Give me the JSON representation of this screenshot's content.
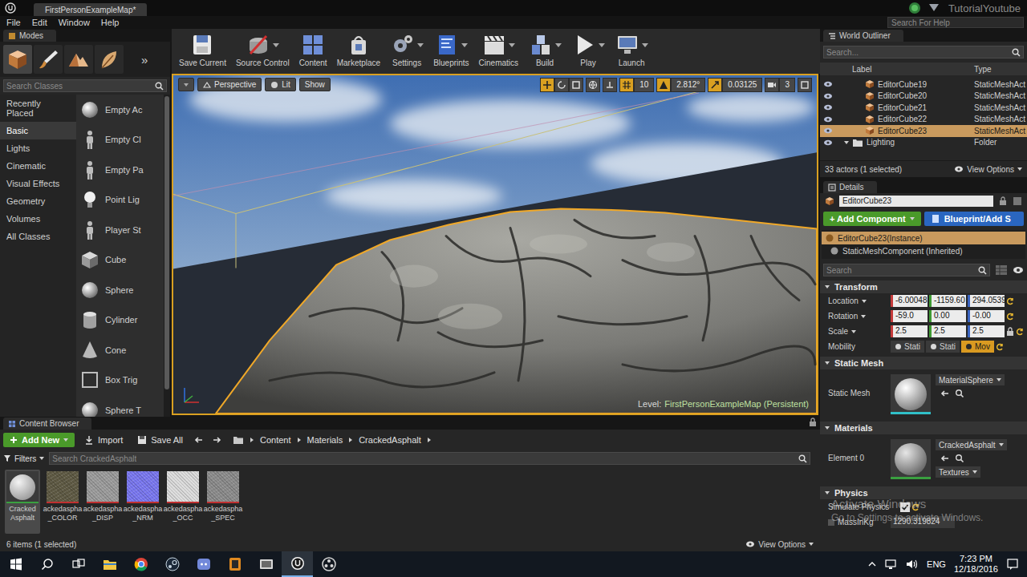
{
  "window": {
    "title": "FirstPersonExampleMap*",
    "account": "TutorialYoutube",
    "help_search": "Search For Help"
  },
  "menu": [
    "File",
    "Edit",
    "Window",
    "Help"
  ],
  "modes": {
    "tab": "Modes",
    "more": "»",
    "search": "Search Classes",
    "categories": [
      {
        "label": "Recently Placed",
        "selected": false
      },
      {
        "label": "Basic",
        "selected": true
      },
      {
        "label": "Lights",
        "selected": false
      },
      {
        "label": "Cinematic",
        "selected": false
      },
      {
        "label": "Visual Effects",
        "selected": false
      },
      {
        "label": "Geometry",
        "selected": false
      },
      {
        "label": "Volumes",
        "selected": false
      },
      {
        "label": "All Classes",
        "selected": false
      }
    ],
    "items": [
      "Empty Ac",
      "Empty Cl",
      "Empty Pa",
      "Point Lig",
      "Player St",
      "Cube",
      "Sphere",
      "Cylinder",
      "Cone",
      "Box Trig",
      "Sphere T"
    ]
  },
  "toolbar": [
    {
      "label": "Save Current",
      "dropdown": false
    },
    {
      "label": "Source Control",
      "dropdown": true
    },
    {
      "label": "Content",
      "dropdown": false
    },
    {
      "label": "Marketplace",
      "dropdown": false
    },
    {
      "label": "Settings",
      "dropdown": true
    },
    {
      "label": "Blueprints",
      "dropdown": true
    },
    {
      "label": "Cinematics",
      "dropdown": true
    },
    {
      "label": "Build",
      "dropdown": true
    },
    {
      "label": "Play",
      "dropdown": true
    },
    {
      "label": "Launch",
      "dropdown": true
    }
  ],
  "viewport": {
    "view": "Perspective",
    "lighting": "Lit",
    "show": "Show",
    "grid": "10",
    "angle": "2.812°",
    "scale": "0.03125",
    "camera_speed": "3",
    "level_label": "Level:",
    "level": "FirstPersonExampleMap (Persistent)"
  },
  "outliner": {
    "tab": "World Outliner",
    "search": "Search...",
    "columns": [
      "Label",
      "Type"
    ],
    "rows": [
      {
        "label": "EditorCube19",
        "type": "StaticMeshAct",
        "kind": "actor",
        "selected": false,
        "expanded": false
      },
      {
        "label": "EditorCube20",
        "type": "StaticMeshAct",
        "kind": "actor",
        "selected": false,
        "expanded": false
      },
      {
        "label": "EditorCube21",
        "type": "StaticMeshAct",
        "kind": "actor",
        "selected": false,
        "expanded": false
      },
      {
        "label": "EditorCube22",
        "type": "StaticMeshAct",
        "kind": "actor",
        "selected": false,
        "expanded": false
      },
      {
        "label": "EditorCube23",
        "type": "StaticMeshAct",
        "kind": "actor",
        "selected": true,
        "expanded": false
      },
      {
        "label": "Lighting",
        "type": "Folder",
        "kind": "folder",
        "selected": false,
        "expanded": true
      }
    ],
    "status": "33 actors (1 selected)",
    "view_options": "View Options"
  },
  "details": {
    "tab": "Details",
    "name": "EditorCube23",
    "add_component": "+ Add Component",
    "blueprint": "Blueprint/Add S",
    "components": [
      {
        "label": "EditorCube23(Instance)",
        "selected": true
      },
      {
        "label": "StaticMeshComponent (Inherited)",
        "selected": false
      }
    ],
    "search": "Search",
    "transform": {
      "title": "Transform",
      "rows": [
        {
          "label": "Location",
          "values": [
            "-6.00048",
            "-1159.60",
            "294.0539"
          ]
        },
        {
          "label": "Rotation",
          "values": [
            "-59.0",
            "0.00",
            "-0.00"
          ]
        },
        {
          "label": "Scale",
          "values": [
            "2.5",
            "2.5",
            "2.5"
          ]
        }
      ],
      "scale_locked": true,
      "mobility_label": "Mobility",
      "mobility": [
        {
          "label": "Stati",
          "selected": false
        },
        {
          "label": "Stati",
          "selected": false
        },
        {
          "label": "Mov",
          "selected": true
        }
      ]
    },
    "static_mesh": {
      "title": "Static Mesh",
      "label": "Static Mesh",
      "value": "MaterialSphere"
    },
    "materials": {
      "title": "Materials",
      "label": "Element 0",
      "value": "CrackedAsphalt",
      "textures": "Textures"
    },
    "physics": {
      "title": "Physics",
      "simulate_label": "Simulate Physics",
      "simulate_checked": true,
      "mass_label": "MassInKg",
      "mass": "1290.319824"
    }
  },
  "content_browser": {
    "tab": "Content Browser",
    "add_new": "Add New",
    "import": "Import",
    "save_all": "Save All",
    "path": [
      "Content",
      "Materials",
      "CrackedAsphalt"
    ],
    "filters": "Filters",
    "search": "Search CrackedAsphalt",
    "assets": [
      {
        "lines": [
          "Cracked",
          "Asphalt"
        ],
        "kind": "material",
        "selected": true,
        "color": "#9a9a9a"
      },
      {
        "lines": [
          "ackedaspha",
          "_COLOR"
        ],
        "kind": "texture",
        "selected": false,
        "color": "#5f5a44"
      },
      {
        "lines": [
          "ackedaspha",
          "_DISP"
        ],
        "kind": "texture",
        "selected": false,
        "color": "#9c9c9c"
      },
      {
        "lines": [
          "ackedaspha",
          "_NRM"
        ],
        "kind": "texture",
        "selected": false,
        "color": "#7a78f0"
      },
      {
        "lines": [
          "ackedaspha",
          "_OCC"
        ],
        "kind": "texture",
        "selected": false,
        "color": "#dcdcdc"
      },
      {
        "lines": [
          "ackedaspha",
          "_SPEC"
        ],
        "kind": "texture",
        "selected": false,
        "color": "#8c8c8c"
      }
    ],
    "status": "6 items (1 selected)",
    "view_options": "View Options"
  },
  "watermark": {
    "title": "Activate Windows",
    "text": "Go to Settings to activate Windows."
  },
  "taskbar": {
    "language": "ENG",
    "time": "7:23 PM",
    "date": "12/18/2016"
  }
}
